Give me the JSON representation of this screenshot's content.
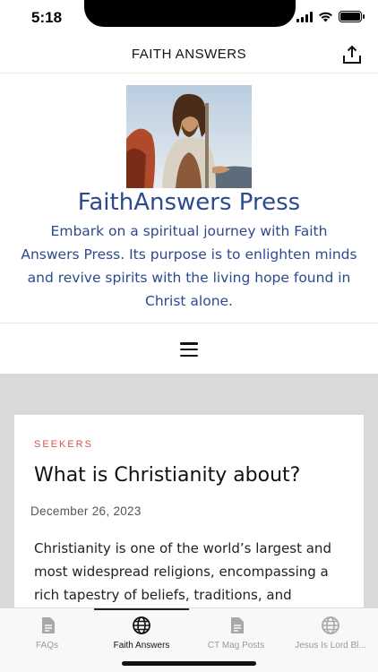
{
  "status_bar": {
    "time": "5:18"
  },
  "nav": {
    "title": "FAITH ANSWERS"
  },
  "hero": {
    "site_title": "FaithAnswers Press",
    "description": "Embark on a spiritual journey with Faith Answers Press. Its purpose is to enlighten minds and revive spirits with the living hope found in Christ alone."
  },
  "post": {
    "category": "SEEKERS",
    "title": "What is Christianity about?",
    "date": "December 26, 2023",
    "excerpt": "Christianity is one of the world’s largest and most widespread religions, encompassing a rich tapestry of beliefs, traditions, and"
  },
  "tabs": [
    {
      "label": "FAQs",
      "icon": "document-icon"
    },
    {
      "label": "Faith Answers",
      "icon": "globe-icon"
    },
    {
      "label": "CT Mag Posts",
      "icon": "document-icon"
    },
    {
      "label": "Jesus Is Lord Bl...",
      "icon": "globe-icon"
    }
  ],
  "colors": {
    "accent_blue": "#2c4a8f",
    "category_red": "#d9534f",
    "content_gray": "#d9d9d9"
  }
}
